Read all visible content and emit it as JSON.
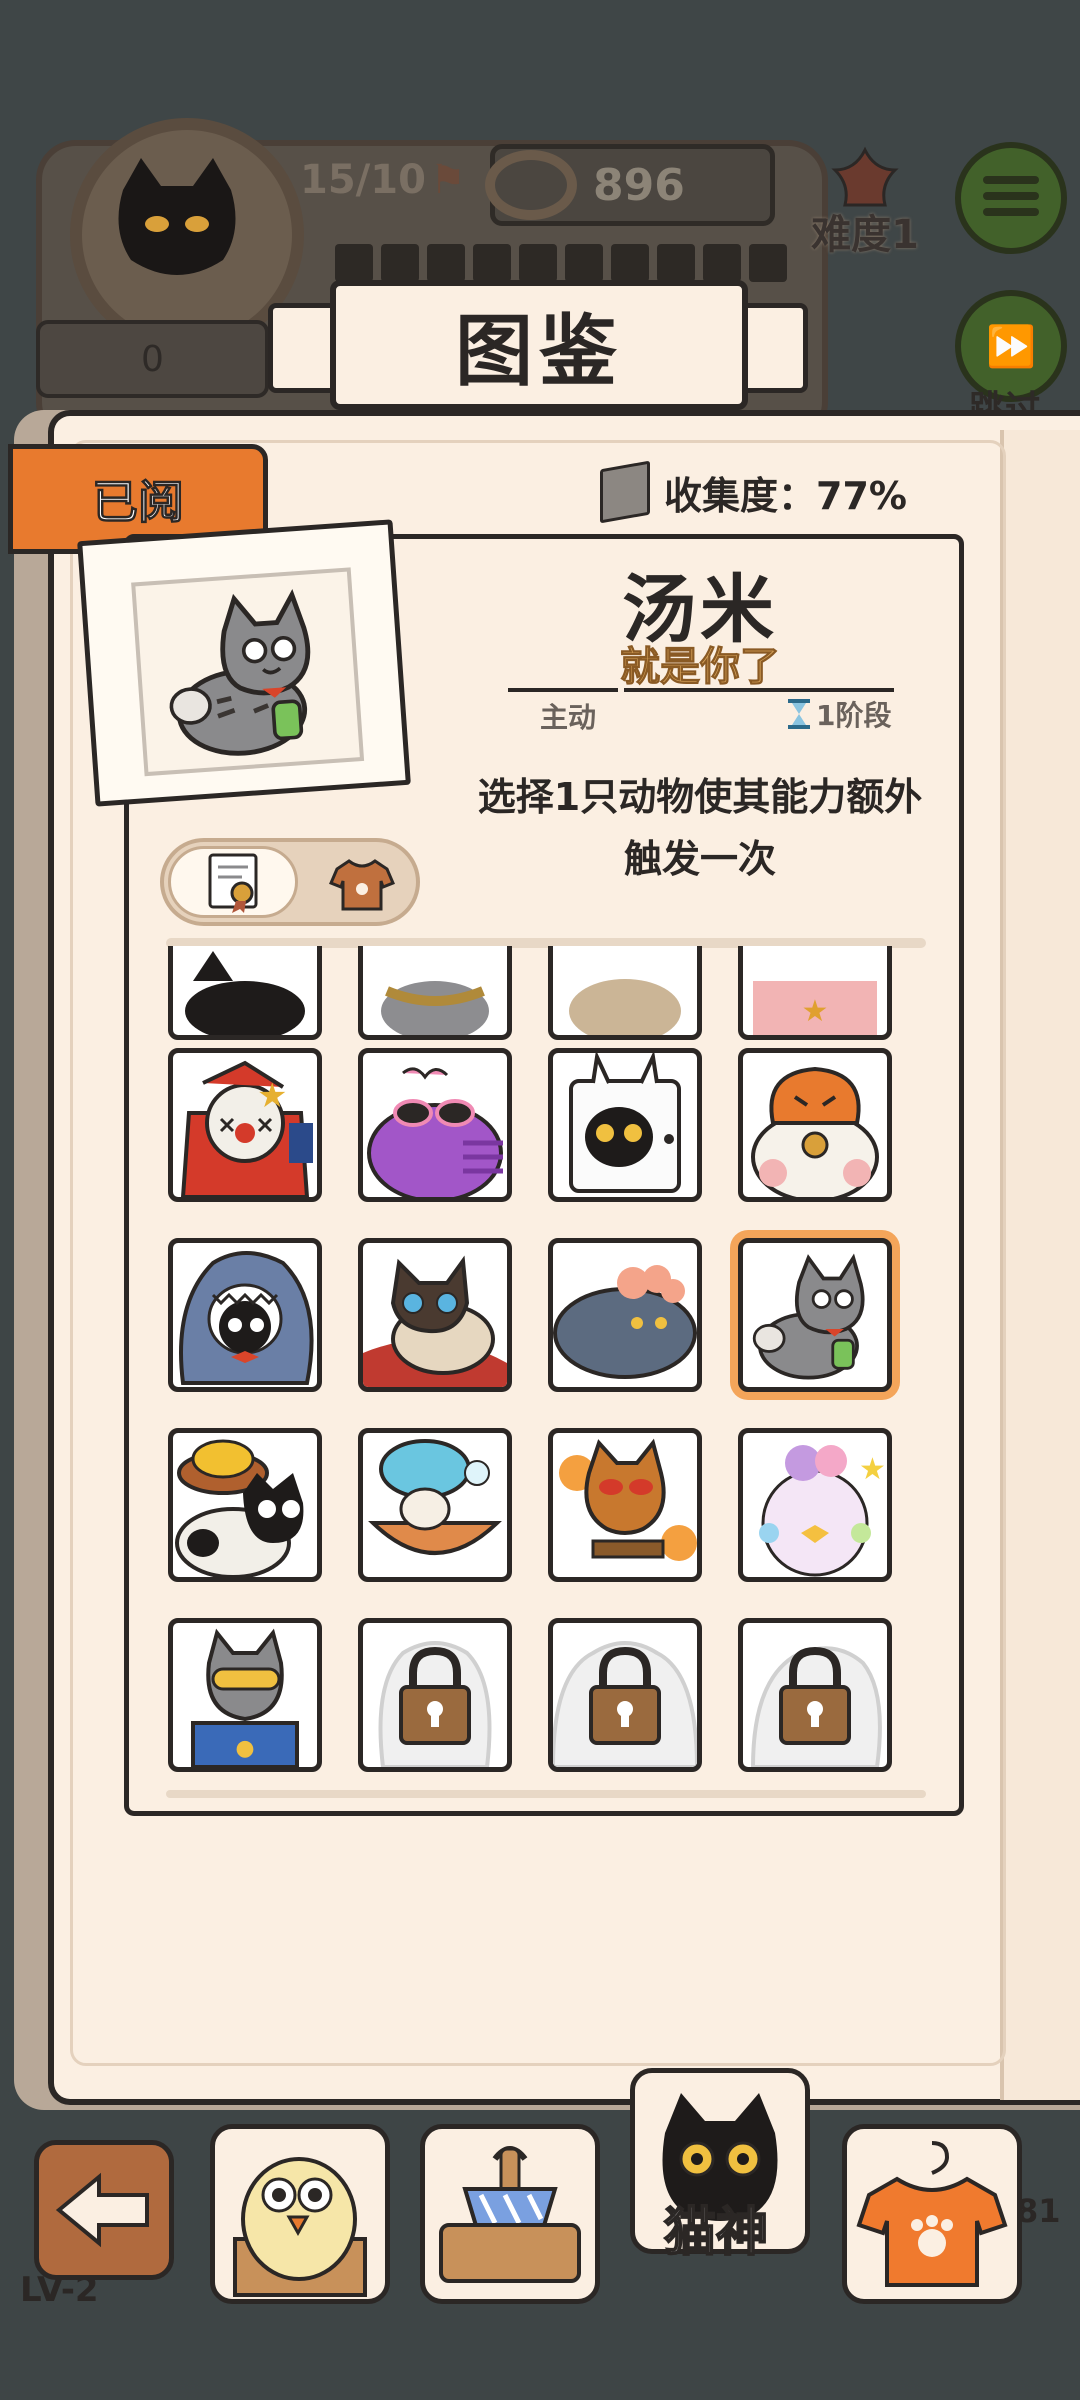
{
  "hud": {
    "flags": "15/10",
    "coins": "896",
    "difficulty": "难度1",
    "score": "0",
    "skip_label": "跳过"
  },
  "title": "图鉴",
  "read_tab": "已阅",
  "collection": {
    "label": "收集度：77%"
  },
  "detail": {
    "name": "汤米",
    "subtitle": "就是你了",
    "type": "主动",
    "stage": "1阶段",
    "description_line1": "选择1只动物使其能力额外",
    "description_line2": "触发一次"
  },
  "grid": {
    "rows": [
      [
        "black-cat",
        "chain-cat",
        "tan-cat",
        "pink-dress-cat"
      ],
      [
        "clown-cat",
        "pink-sunglasses-cat",
        "bunny-cube-cat",
        "lucky-calico-cat"
      ],
      [
        "shark-costume-cat",
        "siamese-cat",
        "grey-blob-cat",
        "tabby-glasses-cat"
      ],
      [
        "cowboy-hat-cat",
        "shower-cap-cat",
        "explosive-tabby-cat",
        "pastel-fluffy-cat"
      ],
      [
        "goggles-robot-cat",
        "locked",
        "locked",
        "locked"
      ]
    ],
    "selected": "tabby-glasses-cat"
  },
  "nav": {
    "level": "LV-2",
    "cat_god_label": "猫神",
    "counter": "81"
  },
  "colors": {
    "accent_orange": "#e87a2e",
    "paper": "#fbefe2",
    "ink": "#2b2725",
    "selection": "#f4a55a"
  }
}
